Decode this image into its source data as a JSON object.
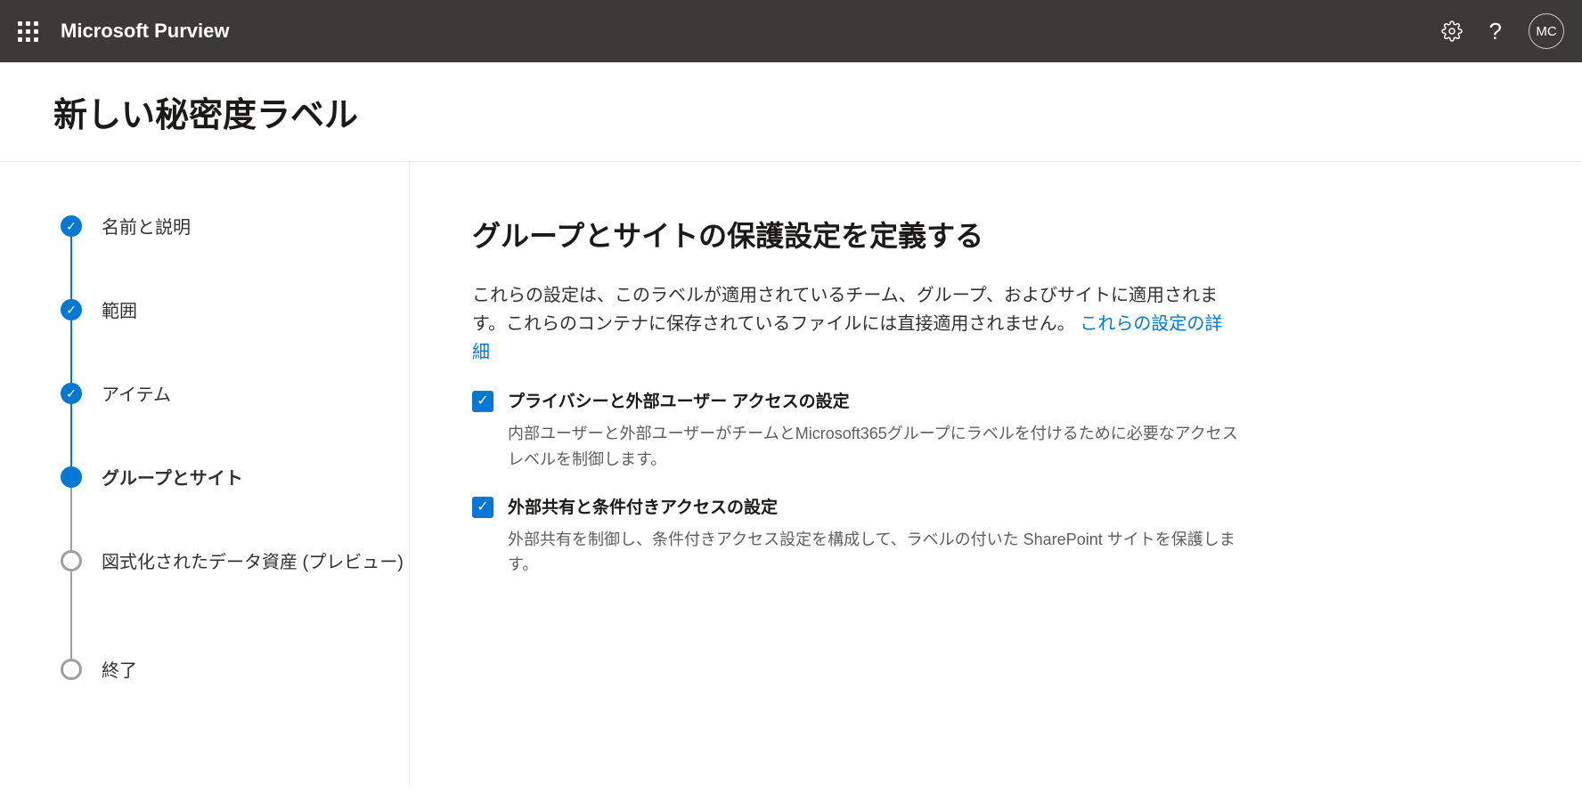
{
  "header": {
    "product_name": "Microsoft Purview",
    "avatar_initials": "MC"
  },
  "page": {
    "title": "新しい秘密度ラベル"
  },
  "wizard": {
    "steps": [
      {
        "label": "名前と説明",
        "status": "completed"
      },
      {
        "label": "範囲",
        "status": "completed"
      },
      {
        "label": "アイテム",
        "status": "completed"
      },
      {
        "label": "グループとサイト",
        "status": "current"
      },
      {
        "label": "図式化されたデータ資産 (プレビュー)",
        "status": "upcoming"
      },
      {
        "label": "終了",
        "status": "upcoming"
      }
    ]
  },
  "content": {
    "heading": "グループとサイトの保護設定を定義する",
    "description_prefix": "これらの設定は、このラベルが適用されているチーム、グループ、およびサイトに適用されます。これらのコンテナに保存されているファイルには直接適用されません。 ",
    "learn_more": "これらの設定の詳細",
    "options": [
      {
        "label": "プライバシーと外部ユーザー アクセスの設定",
        "description": "内部ユーザーと外部ユーザーがチームとMicrosoft365グループにラベルを付けるために必要なアクセスレベルを制御します。",
        "checked": true
      },
      {
        "label": "外部共有と条件付きアクセスの設定",
        "description": "外部共有を制御し、条件付きアクセス設定を構成して、ラベルの付いた SharePoint サイトを保護します。",
        "checked": true
      }
    ]
  }
}
